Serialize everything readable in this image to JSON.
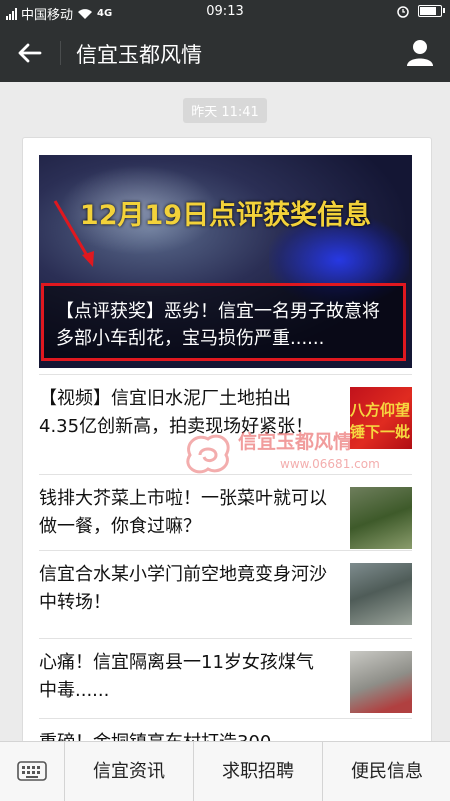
{
  "status_bar": {
    "carrier": "中国移动",
    "network": "4G",
    "time": "09:13"
  },
  "header": {
    "title": "信宜玉都风情"
  },
  "chat": {
    "timestamp": "昨天 11:41"
  },
  "article": {
    "cover_headline": "12月19日点评获奖信息",
    "cover_caption": "【点评获奖】恶劣！信宜一名男子故意将多部小车刮花，宝马损伤严重......",
    "items": [
      {
        "title": "【视频】信宜旧水泥厂土地拍出4.35亿创新高，拍卖现场好紧张！",
        "thumb_text_1": "八方仰望",
        "thumb_text_2": "锤下一妣"
      },
      {
        "title": "钱排大芥菜上市啦！一张菜叶就可以做一餐，你食过嘛？"
      },
      {
        "title": "信宜合水某小学门前空地竟变身河沙中转场！"
      },
      {
        "title": "心痛！信宜隔离县一11岁女孩煤气中毒......"
      },
      {
        "title": "重磅！金垌镇高车村打造300"
      }
    ]
  },
  "watermark": {
    "text": "信宜玉都风情",
    "url": "www.06681.com"
  },
  "bottom_menu": {
    "items": [
      "信宜资讯",
      "求职招聘",
      "便民信息"
    ]
  }
}
